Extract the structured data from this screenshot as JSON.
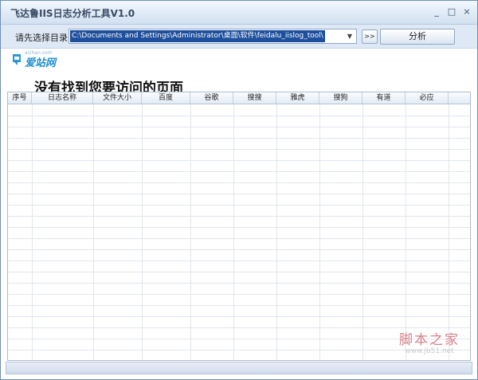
{
  "window": {
    "title": "飞达鲁IIS日志分析工具V1.0",
    "minimize_glyph": "_",
    "maximize_glyph": "□",
    "close_glyph": "×"
  },
  "toolbar": {
    "dir_label": "请先选择目录",
    "path_value": "C:\\Documents and Settings\\Administrator\\桌面\\软件\\feidalu_iislog_tool\\",
    "browse_label": ">>",
    "analyze_label": "分析"
  },
  "logo": {
    "text": "爱站网",
    "sub": "aizhan.com"
  },
  "message": "没有找到您要访问的页面",
  "table": {
    "columns": [
      "序号",
      "日志名称",
      "文件大小",
      "百度",
      "谷歌",
      "搜搜",
      "雅虎",
      "搜狗",
      "有道",
      "必应"
    ],
    "row_count_visible": 0
  },
  "watermark": {
    "line1": "脚本之家",
    "line2": "www.jb51.net"
  },
  "colors": {
    "accent": "#1d4f9c",
    "title_text": "#3a4a63",
    "grid_line": "#e1e6ee",
    "watermark": "#d8808a"
  }
}
